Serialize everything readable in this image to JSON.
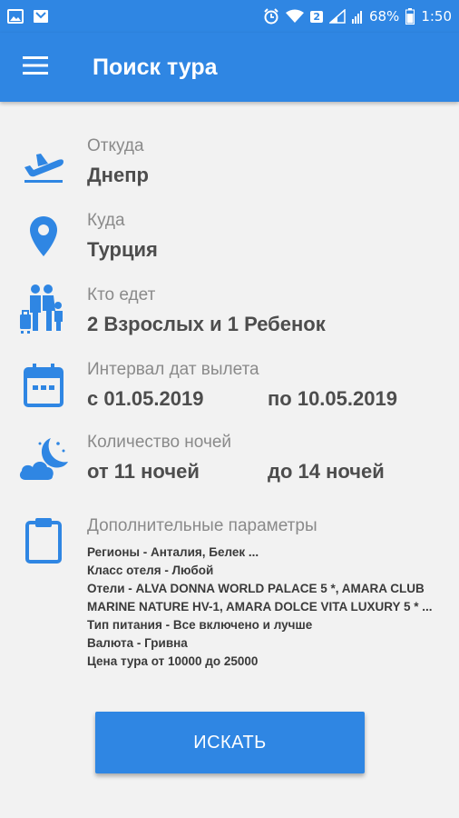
{
  "status_bar": {
    "badge": "2",
    "battery": "68%",
    "time": "1:50"
  },
  "app_bar": {
    "title": "Поиск тура"
  },
  "form": {
    "from": {
      "label": "Откуда",
      "value": "Днепр"
    },
    "to": {
      "label": "Куда",
      "value": "Турция"
    },
    "travelers": {
      "label": "Кто едет",
      "value": "2 Взрослых и 1 Ребенок"
    },
    "dates": {
      "label": "Интервал дат вылета",
      "from": "с 01.05.2019",
      "to": "по 10.05.2019"
    },
    "nights": {
      "label": "Количество ночей",
      "from": "от 11 ночей",
      "to": "до 14 ночей"
    },
    "extra": {
      "label": "Дополнительные параметры",
      "lines": [
        "Регионы - Анталия, Белек ...",
        "Класс отеля - Любой",
        "Отели - ALVA DONNA WORLD PALACE 5 *, AMARA CLUB MARINE NATURE HV-1, AMARA DOLCE VITA LUXURY 5 * ...",
        "Тип питания - Все включено и лучше",
        "Валюта - Гривна",
        "Цена тура от 10000 до 25000"
      ]
    }
  },
  "search_button": {
    "label": "ИСКАТЬ"
  },
  "colors": {
    "primary": "#2f86e3",
    "background": "#f2f2f2"
  },
  "icons": [
    "gallery-icon",
    "notification-icon",
    "alarm-icon",
    "wifi-icon",
    "signal-icon",
    "battery-icon",
    "menu-icon",
    "plane-departure-icon",
    "location-pin-icon",
    "family-icon",
    "calendar-icon",
    "moon-cloud-icon",
    "clipboard-icon"
  ]
}
